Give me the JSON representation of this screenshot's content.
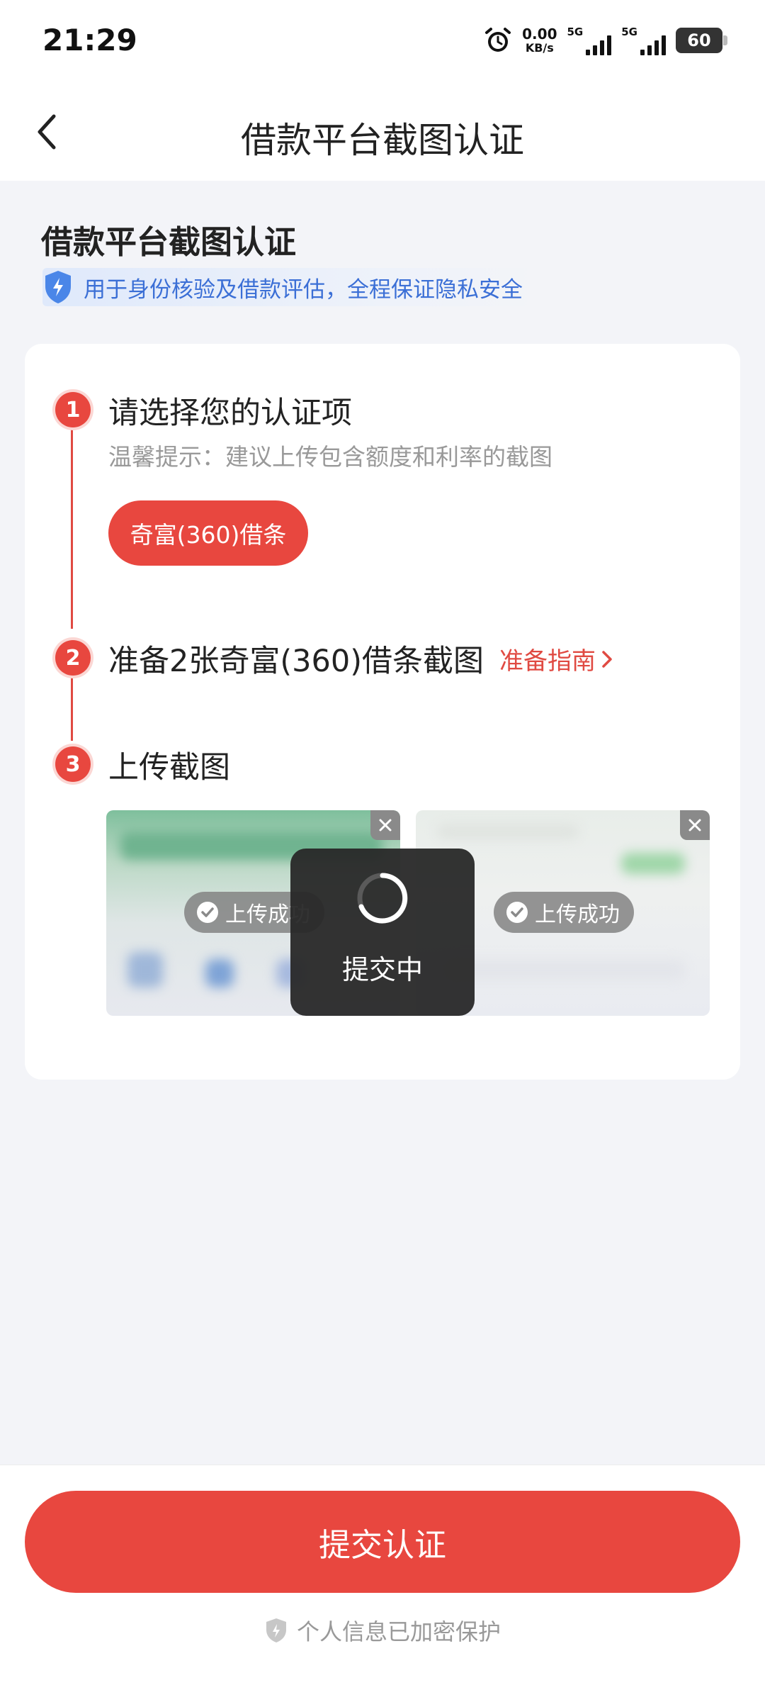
{
  "status_bar": {
    "time": "21:29",
    "net_speed_value": "0.00",
    "net_speed_unit": "KB/s",
    "sim1_label": "5G",
    "sim2_label": "5G",
    "battery": "60"
  },
  "nav": {
    "title": "借款平台截图认证"
  },
  "header": {
    "title": "借款平台截图认证",
    "privacy_text": "用于身份核验及借款评估，全程保证隐私安全"
  },
  "steps": [
    {
      "num": "1",
      "title": "请选择您的认证项",
      "hint": "温馨提示：建议上传包含额度和利率的截图",
      "chip_label": "奇富(360)借条"
    },
    {
      "num": "2",
      "title": "准备2张奇富(360)借条截图",
      "guide_label": "准备指南"
    },
    {
      "num": "3",
      "title": "上传截图"
    }
  ],
  "uploads": [
    {
      "status": "上传成功"
    },
    {
      "status": "上传成功"
    }
  ],
  "toast": {
    "text": "提交中"
  },
  "bottom": {
    "submit_label": "提交认证",
    "secure_text": "个人信息已加密保护"
  },
  "colors": {
    "accent": "#e8473f",
    "link_blue": "#3b6fd6"
  }
}
